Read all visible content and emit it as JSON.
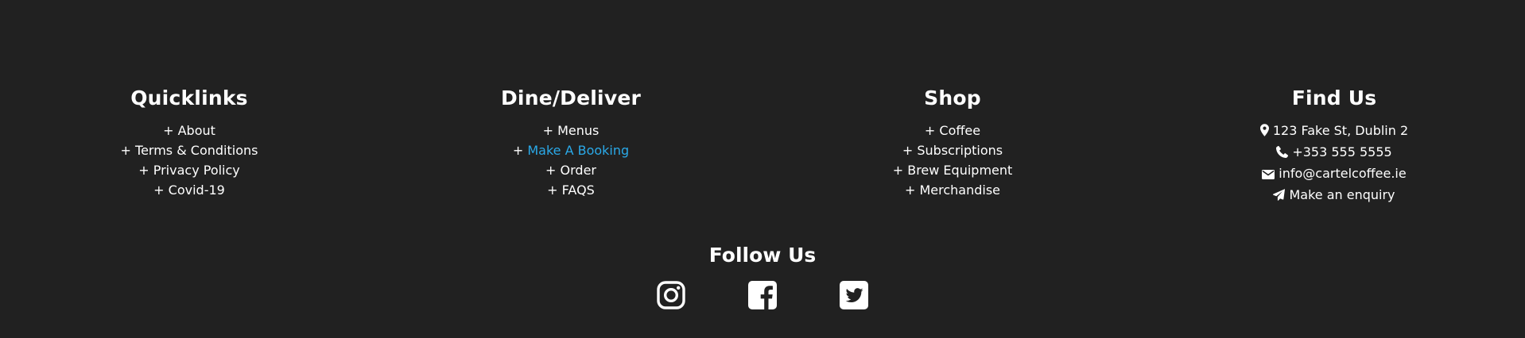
{
  "quicklinks": {
    "title": "Quicklinks",
    "items": [
      "+ About",
      "+ Terms & Conditions",
      "+ Privacy Policy",
      "+ Covid-19"
    ]
  },
  "dine": {
    "title": "Dine/Deliver",
    "items": [
      {
        "prefix": "+ ",
        "label": "Menus"
      },
      {
        "prefix": "+ ",
        "label": "Make A Booking"
      },
      {
        "prefix": "+ ",
        "label": "Order"
      },
      {
        "prefix": "+ ",
        "label": "FAQS"
      }
    ],
    "highlight_color": "#2aa9e8"
  },
  "shop": {
    "title": "Shop",
    "items": [
      "+ Coffee",
      "+ Subscriptions",
      "+ Brew Equipment",
      "+ Merchandise"
    ]
  },
  "findus": {
    "title": "Find Us",
    "items": [
      {
        "icon": "map-marker-icon",
        "label": "123 Fake St, Dublin 2"
      },
      {
        "icon": "phone-icon",
        "label": "+353 555 5555"
      },
      {
        "icon": "envelope-icon",
        "label": "info@cartelcoffee.ie"
      },
      {
        "icon": "paper-plane-icon",
        "label": "Make an enquiry"
      }
    ]
  },
  "follow": {
    "title": "Follow Us",
    "icons": [
      "instagram-icon",
      "facebook-icon",
      "twitter-icon"
    ]
  },
  "colors": {
    "background": "#212121",
    "text": "#ffffff",
    "accent": "#2aa9e8"
  }
}
